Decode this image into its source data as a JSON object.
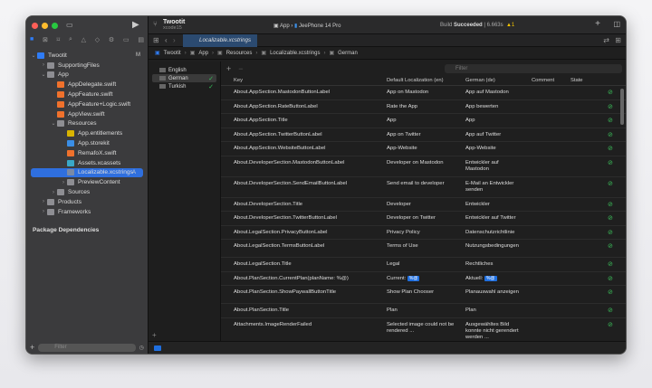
{
  "window": {
    "project": "Twootit",
    "branch": "xcode15",
    "scheme": "App",
    "device": "JeePhone 14 Pro",
    "build_prefix": "Build",
    "build_status": "Succeeded",
    "build_time": "| 6.663s",
    "warning_count": "1"
  },
  "navigator": {
    "items": [
      {
        "label": "Twootit",
        "level": 0,
        "badge": "M",
        "color": "#2f7cf6",
        "open": true
      },
      {
        "label": "SupportingFiles",
        "level": 1,
        "color": "#8e8e93",
        "open": false
      },
      {
        "label": "App",
        "level": 1,
        "color": "#8e8e93",
        "open": true
      },
      {
        "label": "AppDelegate.swift",
        "level": 2,
        "color": "#f0712c"
      },
      {
        "label": "AppFeature.swift",
        "level": 2,
        "color": "#f0712c"
      },
      {
        "label": "AppFeature+Logic.swift",
        "level": 2,
        "color": "#f0712c"
      },
      {
        "label": "AppView.swift",
        "level": 2,
        "color": "#f0712c"
      },
      {
        "label": "Resources",
        "level": 2,
        "color": "#8e8e93",
        "open": true
      },
      {
        "label": "App.entitlements",
        "level": 3,
        "color": "#d9b400"
      },
      {
        "label": "App.storekit",
        "level": 3,
        "color": "#3a8ee6"
      },
      {
        "label": "RemafoX.swift",
        "level": 3,
        "color": "#f0712c"
      },
      {
        "label": "Assets.xcassets",
        "level": 3,
        "color": "#3aa8c8"
      },
      {
        "label": "Localizable.xcstrings",
        "level": 3,
        "badge": "A",
        "color": "#7a8aa6",
        "selected": true
      },
      {
        "label": "PreviewContent",
        "level": 3,
        "color": "#8e8e93",
        "open": false
      },
      {
        "label": "Sources",
        "level": 2,
        "color": "#8e8e93",
        "open": false
      },
      {
        "label": "Products",
        "level": 1,
        "color": "#8e8e93",
        "open": false
      },
      {
        "label": "Frameworks",
        "level": 1,
        "color": "#8e8e93",
        "open": false
      }
    ],
    "package_dependencies": "Package Dependencies",
    "filter_placeholder": "Filter"
  },
  "editor": {
    "tab": "Localizable.xcstrings",
    "breadcrumb": [
      "Twootit",
      "App",
      "Resources",
      "Localizable.xcstrings",
      "German"
    ],
    "languages": [
      {
        "label": "English",
        "state": ""
      },
      {
        "label": "German",
        "state": "✓",
        "selected": true
      },
      {
        "label": "Turkish",
        "state": "✓"
      }
    ],
    "filter_placeholder": "Filter",
    "columns": [
      "Key",
      "Default Localization (en)",
      "German (de)",
      "Comment",
      "State"
    ],
    "rows": [
      {
        "key": "About.AppSection.MastodonButtonLabel",
        "en": "App on Mastodon",
        "de": "App auf Mastodon"
      },
      {
        "key": "About.AppSection.RateButtonLabel",
        "en": "Rate the App",
        "de": "App bewerten"
      },
      {
        "key": "About.AppSection.Title",
        "en": "App",
        "de": "App"
      },
      {
        "key": "About.AppSection.TwitterButtonLabel",
        "en": "App on Twitter",
        "de": "App auf Twitter"
      },
      {
        "key": "About.AppSection.WebsiteButtonLabel",
        "en": "App-Website",
        "de": "App-Website"
      },
      {
        "key": "About.DeveloperSection.MastodonButtonLabel",
        "en": "Developer on Mastodon",
        "de": "Entwickler auf Mastodon"
      },
      {
        "key": "About.DeveloperSection.SendEmailButtonLabel",
        "en": "Send email to developer",
        "de": "E-Mail an Entwickler senden"
      },
      {
        "key": "About.DeveloperSection.Title",
        "en": "Developer",
        "de": "Entwickler"
      },
      {
        "key": "About.DeveloperSection.TwitterButtonLabel",
        "en": "Developer on Twitter",
        "de": "Entwickler auf Twitter"
      },
      {
        "key": "About.LegalSection.PrivacyButtonLabel",
        "en": "Privacy Policy",
        "de": "Datenschutzrichtlinie"
      },
      {
        "key": "About.LegalSection.TermsButtonLabel",
        "en": "Terms of Use",
        "de": "Nutzungsbedingungen"
      },
      {
        "key": "About.LegalSection.Title",
        "en": "Legal",
        "de": "Rechtliches"
      },
      {
        "key": "About.PlanSection.CurrentPlan(planName: %@)",
        "en": "Current: ",
        "de": "Aktuell: ",
        "token": "%@"
      },
      {
        "key": "About.PlanSection.ShowPaywallButtonTitle",
        "en": "Show Plan Chooser",
        "de": "Planauswahl anzeigen"
      },
      {
        "key": "About.PlanSection.Title",
        "en": "Plan",
        "de": "Plan"
      },
      {
        "key": "Attachments.ImageRenderFailed",
        "en": "Selected image could not be rendered ...",
        "de": "Ausgewähltes Bild konnte nicht gerendert werden ..."
      }
    ],
    "state_icon": "checkmark-circle-icon",
    "state_color": "#3bbf5a"
  }
}
